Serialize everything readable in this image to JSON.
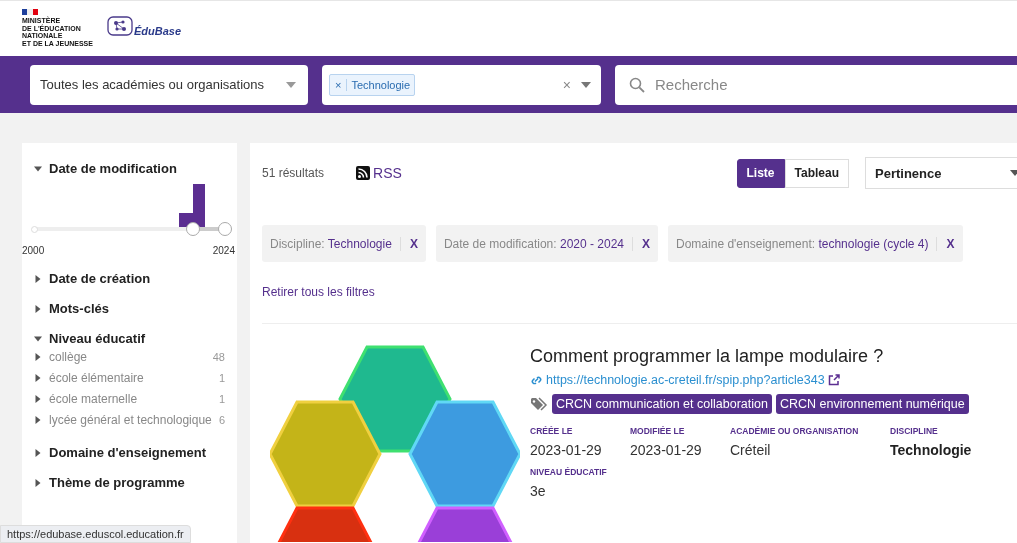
{
  "header": {
    "ministry_lines": [
      "MINISTÈRE",
      "DE L'ÉDUCATION",
      "NATIONALE",
      "ET DE LA JEUNESSE"
    ],
    "logo_text": "ÉduBase"
  },
  "search_bar": {
    "academy_select": {
      "value": "Toutes les académies ou organisations"
    },
    "discipline_select": {
      "tags": [
        {
          "remove": "×",
          "label": "Technologie"
        }
      ],
      "clear": "×"
    },
    "search": {
      "placeholder": "Recherche"
    }
  },
  "sidebar": {
    "facets": [
      {
        "kind": "range",
        "title": "Date de modification",
        "expanded": true,
        "range_min": "2000",
        "range_max": "2024",
        "thumbs": [
          {
            "level": 0.83
          },
          {
            "level": 1
          }
        ]
      },
      {
        "kind": "list",
        "title": "Date de création",
        "expanded": false
      },
      {
        "kind": "list",
        "title": "Mots-clés",
        "expanded": false
      },
      {
        "kind": "list",
        "title": "Niveau éducatif",
        "expanded": true,
        "items": [
          {
            "label": "collège",
            "count": "48",
            "expanded": false
          },
          {
            "label": "école élémentaire",
            "count": "1",
            "expanded": false
          },
          {
            "label": "école maternelle",
            "count": "1",
            "expanded": false
          },
          {
            "label": "lycée général et technologique",
            "count": "6",
            "expanded": false
          }
        ]
      },
      {
        "kind": "list",
        "title": "Domaine d'enseignement",
        "expanded": false
      },
      {
        "kind": "list",
        "title": "Thème de programme",
        "expanded": false
      }
    ]
  },
  "results": {
    "count": "51 résultats",
    "rss": "RSS",
    "views": [
      {
        "label": "Liste",
        "selected": true
      },
      {
        "label": "Tableau",
        "selected": false
      }
    ],
    "sort": "Pertinence",
    "filters": [
      {
        "name": "Discipline:",
        "value": "Technologie",
        "remove": "X"
      },
      {
        "name": "Date de modification:",
        "value": "2020 - 2024",
        "remove": "X"
      },
      {
        "name": "Domaine d'enseignement:",
        "value": "technologie (cycle 4)",
        "remove": "X"
      }
    ],
    "clear_filters": "Retirer tous les filtres",
    "items": [
      {
        "title": "Comment programmer la lampe modulaire ?",
        "url": "https://technologie.ac-creteil.fr/spip.php?article343",
        "tags": [
          "CRCN communication et collaboration",
          "CRCN environnement numérique"
        ],
        "fields": [
          {
            "label": "CRÉÉE LE",
            "value": "2023-01-29",
            "bold": false
          },
          {
            "label": "MODIFIÉE LE",
            "value": "2023-01-29",
            "bold": false
          },
          {
            "label": "ACADÉMIE OU ORGANISATION",
            "value": "Créteil",
            "bold": false
          },
          {
            "label": "DISCIPLINE",
            "value": "Technologie",
            "bold": true
          },
          {
            "label": "NIVEAU ÉDUCATIF",
            "value": "3e",
            "bold": false
          }
        ]
      }
    ]
  },
  "status_bar": {
    "url": "https://edubase.eduscol.education.fr"
  }
}
